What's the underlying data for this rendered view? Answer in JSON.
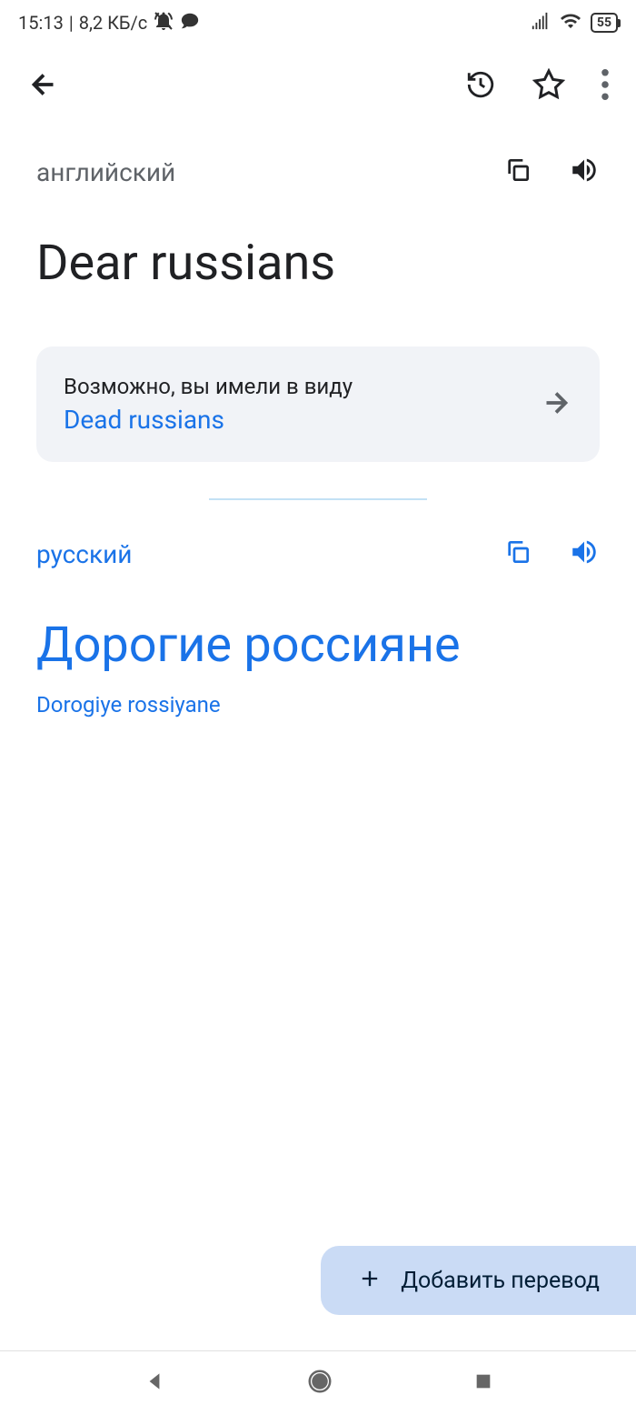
{
  "status_bar": {
    "time": "15:13",
    "data_rate": "8,2 КБ/с",
    "battery": "55"
  },
  "source": {
    "lang_label": "английский",
    "text": "Dear russians"
  },
  "suggestion": {
    "label": "Возможно, вы имели в виду",
    "value": "Dead russians"
  },
  "target": {
    "lang_label": "русский",
    "text": "Дорогие россияне",
    "transliteration": "Dorogiye rossiyane"
  },
  "fab": {
    "label": "Добавить перевод"
  }
}
